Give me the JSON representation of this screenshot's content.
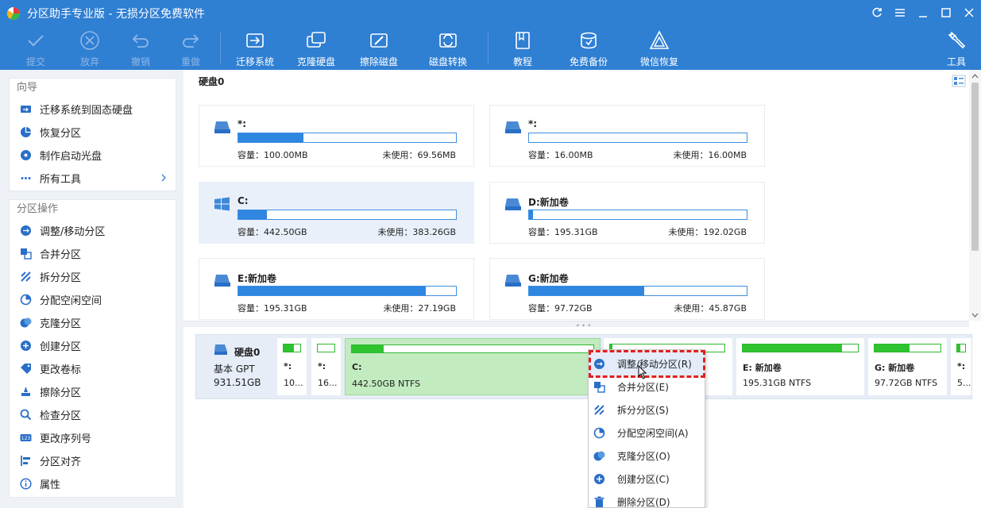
{
  "app": {
    "title": "分区助手专业版 - 无损分区免费软件"
  },
  "toolbar": {
    "commit": "提交",
    "discard": "放弃",
    "undo": "撤销",
    "redo": "重做",
    "migrate_os": "迁移系统",
    "clone_disk": "克隆硬盘",
    "wipe_disk": "擦除磁盘",
    "convert_disk": "磁盘转换",
    "tutorial": "教程",
    "free_backup": "免费备份",
    "wechat_recovery": "微信恢复",
    "tools": "工具"
  },
  "sidebar": {
    "wizard": {
      "title": "向导",
      "items": [
        "迁移系统到固态硬盘",
        "恢复分区",
        "制作启动光盘",
        "所有工具"
      ]
    },
    "partition_ops": {
      "title": "分区操作",
      "items": [
        "调整/移动分区",
        "合并分区",
        "拆分分区",
        "分配空闲空间",
        "克隆分区",
        "创建分区",
        "更改卷标",
        "擦除分区",
        "检查分区",
        "更改序列号",
        "分区对齐",
        "属性"
      ]
    }
  },
  "main": {
    "disk_title": "硬盘0",
    "partitions": [
      {
        "name": "*:",
        "capacity": "容量：100.00MB",
        "free": "未使用：69.56MB",
        "used_pct": 30,
        "icon": "drive-icon",
        "selected": false
      },
      {
        "name": "*:",
        "capacity": "容量：16.00MB",
        "free": "未使用：16.00MB",
        "used_pct": 0,
        "icon": "drive-icon",
        "selected": false
      },
      {
        "name": "C:",
        "capacity": "容量：442.50GB",
        "free": "未使用：383.26GB",
        "used_pct": 13,
        "icon": "windows-icon",
        "selected": true
      },
      {
        "name": "D:新加卷",
        "capacity": "容量：195.31GB",
        "free": "未使用：192.02GB",
        "used_pct": 2,
        "icon": "drive-icon",
        "selected": false
      },
      {
        "name": "E:新加卷",
        "capacity": "容量：195.31GB",
        "free": "未使用：27.19GB",
        "used_pct": 86,
        "icon": "drive-icon",
        "selected": false
      },
      {
        "name": "G:新加卷",
        "capacity": "容量：97.72GB",
        "free": "未使用：45.87GB",
        "used_pct": 53,
        "icon": "drive-icon",
        "selected": false
      }
    ]
  },
  "diskmap": {
    "name": "硬盘0",
    "type": "基本 GPT",
    "size": "931.51GB",
    "blocks": [
      {
        "name": "*:",
        "info": "10...",
        "used_pct": 60,
        "selected": false
      },
      {
        "name": "*:",
        "info": "16...",
        "used_pct": 0,
        "selected": false
      },
      {
        "name": "C:",
        "info": "442.50GB NTFS",
        "used_pct": 13,
        "selected": true
      },
      {
        "name": "",
        "info": "",
        "used_pct": 2,
        "selected": false
      },
      {
        "name": "E: 新加卷",
        "info": "195.31GB NTFS",
        "used_pct": 86,
        "selected": false
      },
      {
        "name": "G: 新加卷",
        "info": "97.72GB NTFS",
        "used_pct": 53,
        "selected": false
      },
      {
        "name": "*:",
        "info": "5...",
        "used_pct": 40,
        "selected": false
      }
    ]
  },
  "context_menu": {
    "items": [
      "调整/移动分区(R)",
      "合并分区(E)",
      "拆分分区(S)",
      "分配空闲空间(A)",
      "克隆分区(O)",
      "创建分区(C)",
      "删除分区(D)"
    ],
    "highlighted": 0
  },
  "colors": {
    "accent": "#2f7fd3",
    "bar_fill": "#2f86e0",
    "disk_fill": "#2fc32f",
    "highlight": "#e02020"
  }
}
